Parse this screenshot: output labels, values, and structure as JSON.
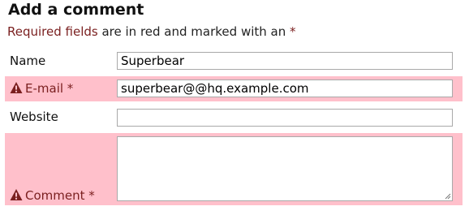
{
  "form": {
    "title": "Add a comment",
    "required_note": {
      "highlight": "Required fields",
      "middle": " are in red and marked with an ",
      "marker": "*"
    },
    "fields": {
      "name": {
        "label": "Name",
        "value": "Superbear"
      },
      "email": {
        "label": "E-mail *",
        "value": "superbear@@hq.example.com"
      },
      "website": {
        "label": "Website",
        "value": ""
      },
      "comment": {
        "label": "Comment *",
        "value": ""
      }
    }
  },
  "colors": {
    "error_background": "#ffc0cb",
    "error_text": "#7a1f1f"
  },
  "icons": {
    "error": "warning-triangle-icon"
  }
}
